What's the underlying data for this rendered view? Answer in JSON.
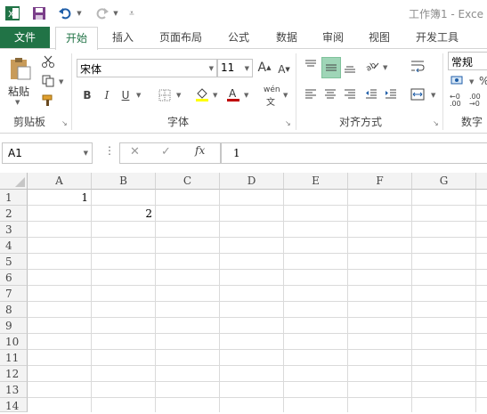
{
  "window": {
    "title": "工作簿1 - Exce"
  },
  "quick_access": {
    "app_icon": "excel-icon",
    "save_icon": "save-icon",
    "undo_icon": "undo-icon",
    "redo_icon": "redo-icon",
    "customize_icon": "customize-icon"
  },
  "tabs": [
    {
      "label": "文件"
    },
    {
      "label": "开始"
    },
    {
      "label": "插入"
    },
    {
      "label": "页面布局"
    },
    {
      "label": "公式"
    },
    {
      "label": "数据"
    },
    {
      "label": "审阅"
    },
    {
      "label": "视图"
    },
    {
      "label": "开发工具"
    }
  ],
  "ribbon": {
    "clipboard": {
      "paste_label": "粘贴",
      "group_label": "剪贴板"
    },
    "font": {
      "font_name": "宋体",
      "font_size": "11",
      "bold": "B",
      "italic": "I",
      "underline": "U",
      "phonetic": "wén",
      "group_label": "字体"
    },
    "alignment": {
      "group_label": "对齐方式"
    },
    "number": {
      "format": "常规",
      "group_label": "数字"
    }
  },
  "formula_bar": {
    "name_box": "A1",
    "cancel": "✕",
    "enter": "✓",
    "fx": "fx",
    "value": "1"
  },
  "sheet": {
    "columns": [
      "A",
      "B",
      "C",
      "D",
      "E",
      "F",
      "G"
    ],
    "rows": [
      "1",
      "2",
      "3",
      "4",
      "5",
      "6",
      "7",
      "8",
      "9",
      "10",
      "11",
      "12",
      "13",
      "14"
    ],
    "cells": {
      "A1": "1",
      "B2": "2"
    }
  },
  "colors": {
    "accent": "#217346",
    "selected": "#9fd5b7"
  }
}
